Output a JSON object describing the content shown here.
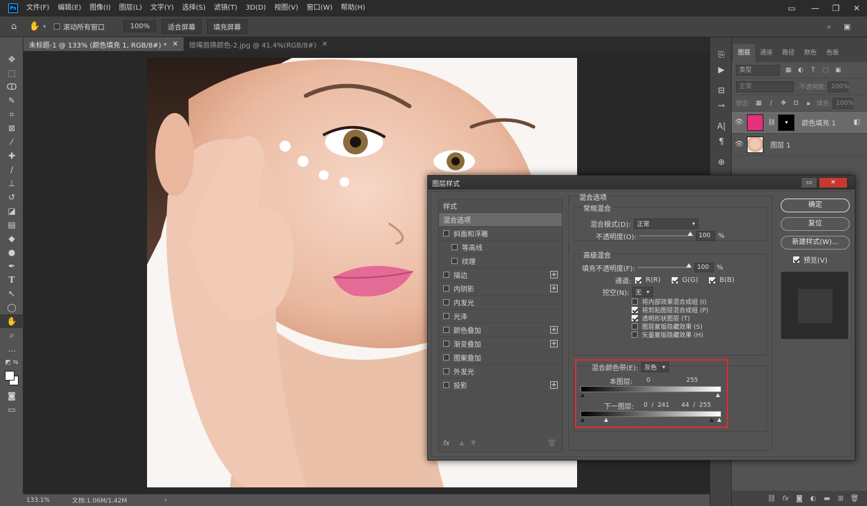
{
  "menubar": {
    "logo": "Ps",
    "items": [
      "文件(F)",
      "编辑(E)",
      "图像(I)",
      "图层(L)",
      "文字(Y)",
      "选择(S)",
      "滤镜(T)",
      "3D(D)",
      "视图(V)",
      "窗口(W)",
      "帮助(H)"
    ]
  },
  "options": {
    "scroll_all": "滚动所有窗口",
    "zoom": "100%",
    "fit_screen": "适合屏幕",
    "fill_screen": "填充屏幕"
  },
  "tabs": {
    "active": "未标题-1 @ 133% (颜色填充 1, RGB/8#) *",
    "inactive": "给嘴唇换颜色-2.jpg @ 41.4%(RGB/8#)"
  },
  "status": {
    "zoom": "133.1%",
    "doc": "文档:1.06M/1.42M"
  },
  "layers_panel": {
    "tabs": [
      "图层",
      "通道",
      "路径",
      "颜色",
      "色板"
    ],
    "filter_placeholder": "类型",
    "blend_mode": "正常",
    "opacity_label": "不透明度:",
    "opacity_value": "100%",
    "lock_label": "锁定:",
    "fill_label": "填充:",
    "fill_value": "100%",
    "layers": [
      {
        "name": "颜色填充 1",
        "color": "#e8307a"
      },
      {
        "name": "图层 1"
      }
    ]
  },
  "dialog": {
    "title": "图层样式",
    "styles_header": "样式",
    "styles": [
      {
        "label": "混合选项",
        "selected": true,
        "check": false,
        "plus": false,
        "indent": false,
        "nocheck": true
      },
      {
        "label": "斜面和浮雕",
        "selected": false,
        "check": false,
        "plus": false,
        "indent": false
      },
      {
        "label": "等高线",
        "selected": false,
        "check": false,
        "plus": false,
        "indent": true
      },
      {
        "label": "纹理",
        "selected": false,
        "check": false,
        "plus": false,
        "indent": true
      },
      {
        "label": "描边",
        "selected": false,
        "check": false,
        "plus": true,
        "indent": false
      },
      {
        "label": "内阴影",
        "selected": false,
        "check": false,
        "plus": true,
        "indent": false
      },
      {
        "label": "内发光",
        "selected": false,
        "check": false,
        "plus": false,
        "indent": false
      },
      {
        "label": "光泽",
        "selected": false,
        "check": false,
        "plus": false,
        "indent": false
      },
      {
        "label": "颜色叠加",
        "selected": false,
        "check": false,
        "plus": true,
        "indent": false
      },
      {
        "label": "渐变叠加",
        "selected": false,
        "check": false,
        "plus": true,
        "indent": false
      },
      {
        "label": "图案叠加",
        "selected": false,
        "check": false,
        "plus": false,
        "indent": false
      },
      {
        "label": "外发光",
        "selected": false,
        "check": false,
        "plus": false,
        "indent": false
      },
      {
        "label": "投影",
        "selected": false,
        "check": false,
        "plus": true,
        "indent": false
      }
    ],
    "fx": "fx",
    "blend_options_title": "混合选项",
    "general_blend": "常规混合",
    "blend_mode_label": "混合模式(D):",
    "blend_mode_value": "正常",
    "opacity_label": "不透明度(O):",
    "opacity_value": "100",
    "percent": "%",
    "advanced_blend": "高级混合",
    "fill_opacity_label": "填充不透明度(F):",
    "fill_opacity_value": "100",
    "channels_label": "通道:",
    "channel_r": "R(R)",
    "channel_g": "G(G)",
    "channel_b": "B(B)",
    "knockout_label": "挖空(N):",
    "knockout_value": "无",
    "checks": [
      {
        "label": "将内部效果混合成组 (I)",
        "checked": false
      },
      {
        "label": "将剪贴图层混合成组 (P)",
        "checked": true
      },
      {
        "label": "透明形状图层 (T)",
        "checked": true
      },
      {
        "label": "图层蒙版隐藏效果 (S)",
        "checked": false
      },
      {
        "label": "矢量蒙版隐藏效果 (H)",
        "checked": false
      }
    ],
    "blend_if_label": "混合颜色带(E):",
    "blend_if_value": "灰色",
    "this_layer_label": "本图层:",
    "this_layer_lo": "0",
    "this_layer_hi": "255",
    "underlying_label": "下一图层:",
    "underlying_values": "0  /  241      44  /  255",
    "underlying_stops": {
      "black_lo": 0,
      "black_hi": 241,
      "white_lo": 44,
      "white_hi": 255
    },
    "btn_ok": "确定",
    "btn_reset": "复位",
    "btn_new_style": "新建样式(W)...",
    "preview_label": "预览(V)"
  }
}
